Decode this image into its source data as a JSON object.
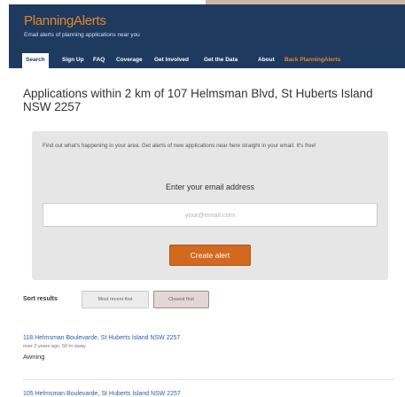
{
  "header": {
    "logo_prefix": "Planning",
    "logo_suffix": "Alerts",
    "tagline": "Email alerts of planning applications near you"
  },
  "nav": {
    "items": [
      {
        "label": "Search"
      },
      {
        "label": "Sign Up"
      },
      {
        "label": "FAQ"
      },
      {
        "label": "Coverage"
      },
      {
        "label": "Get Involved"
      },
      {
        "label": "Get the Data"
      },
      {
        "label": "About"
      },
      {
        "label": "Back PlanningAlerts"
      }
    ]
  },
  "main": {
    "title": "Applications within 2 km of 107 Helmsman Blvd, St Huberts Island NSW 2257"
  },
  "alert": {
    "intro": "Find out what's happening in your area. Get alerts of new applications near here straight in your email. It's free!",
    "email_label": "Enter your email address",
    "email_placeholder": "your@email.com",
    "email_value": "",
    "button_label": "Create alert"
  },
  "sort": {
    "label": "Sort results",
    "options": [
      {
        "label": "Most recent first",
        "selected": false
      },
      {
        "label": "Closest first",
        "selected": true
      }
    ]
  },
  "results": [
    {
      "address": "118 Helmsman Boulevarde, St Huberts Island NSW 2257",
      "meta": "over 2 years ago, 50 m away",
      "description": "Awning"
    },
    {
      "address": "105 Helmsman Boulevarde, St Huberts Island NSW 2257"
    }
  ],
  "colors": {
    "header_bg": "#1f3a5f",
    "accent": "#e8862a",
    "button": "#d2691e",
    "link": "#2a5ea8"
  }
}
